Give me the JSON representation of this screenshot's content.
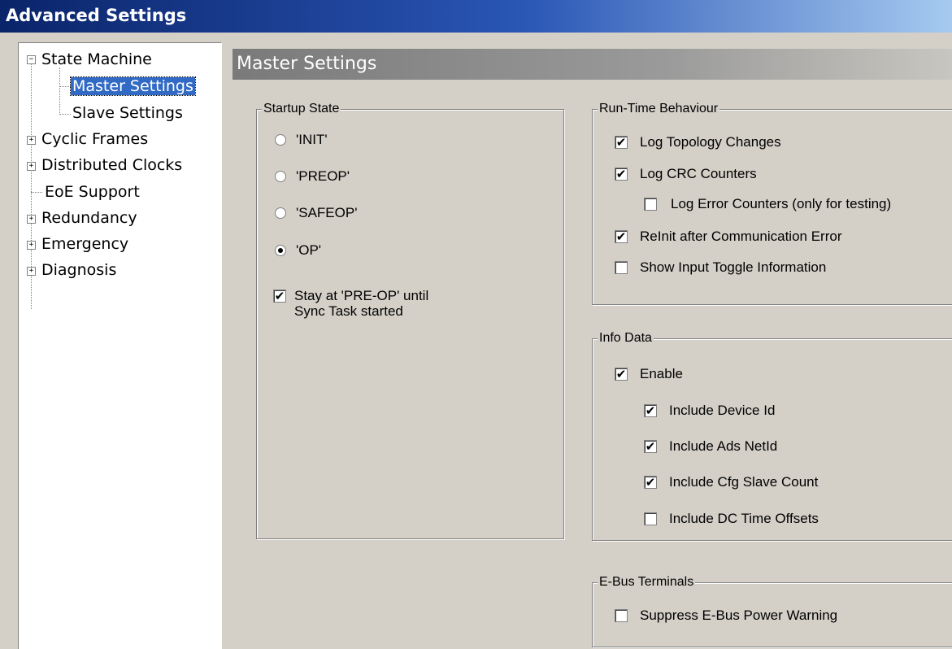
{
  "window": {
    "title": "Advanced Settings"
  },
  "tree": {
    "items": [
      {
        "label": "State Machine",
        "expander": "−",
        "level": 0
      },
      {
        "label": "Master Settings",
        "level": 1,
        "selected": true
      },
      {
        "label": "Slave Settings",
        "level": 1
      },
      {
        "label": "Cyclic Frames",
        "expander": "+",
        "level": 0
      },
      {
        "label": "Distributed Clocks",
        "expander": "+",
        "level": 0
      },
      {
        "label": "EoE Support",
        "level": 0
      },
      {
        "label": "Redundancy",
        "expander": "+",
        "level": 0
      },
      {
        "label": "Emergency",
        "expander": "+",
        "level": 0
      },
      {
        "label": "Diagnosis",
        "expander": "+",
        "level": 0
      }
    ]
  },
  "panel": {
    "title": "Master Settings"
  },
  "startup": {
    "legend": "Startup State",
    "options": [
      {
        "label": "'INIT'",
        "selected": false
      },
      {
        "label": "'PREOP'",
        "selected": false
      },
      {
        "label": "'SAFEOP'",
        "selected": false
      },
      {
        "label": "'OP'",
        "selected": true
      }
    ],
    "stay": {
      "line1": "Stay at 'PRE-OP' until",
      "line2": "Sync Task started",
      "checked": true
    }
  },
  "runtime": {
    "legend": "Run-Time Behaviour",
    "items": [
      {
        "label": "Log Topology Changes",
        "checked": true
      },
      {
        "label": "Log CRC Counters",
        "checked": true
      },
      {
        "label": "Log Error Counters (only for testing)",
        "checked": false
      },
      {
        "label": "ReInit after Communication Error",
        "checked": true
      },
      {
        "label": "Show Input Toggle Information",
        "checked": false
      }
    ]
  },
  "info": {
    "legend": "Info Data",
    "items": [
      {
        "label": "Enable",
        "checked": true
      },
      {
        "label": "Include Device Id",
        "checked": true
      },
      {
        "label": "Include Ads NetId",
        "checked": true
      },
      {
        "label": "Include Cfg Slave Count",
        "checked": true
      },
      {
        "label": "Include DC Time Offsets",
        "checked": false
      }
    ]
  },
  "ebus": {
    "legend": "E-Bus Terminals",
    "items": [
      {
        "label": "Suppress E-Bus Power Warning",
        "checked": false
      }
    ]
  },
  "glyphs": {
    "check": "✔"
  }
}
